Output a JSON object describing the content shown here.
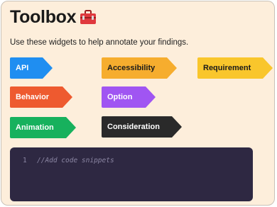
{
  "header": {
    "title": "Toolbox",
    "icon": "toolbox-icon"
  },
  "subtitle": "Use these widgets to help annotate your findings.",
  "tags": [
    {
      "label": "API",
      "color": "#1f8ef1"
    },
    {
      "label": "Accessibility",
      "color": "#f6ad2e"
    },
    {
      "label": "Requirement",
      "color": "#f9c62c"
    },
    {
      "label": "Behavior",
      "color": "#ee5a2f"
    },
    {
      "label": "Option",
      "color": "#a055f2"
    },
    {
      "label": "Animation",
      "color": "#17b15d"
    },
    {
      "label": "Consideration",
      "color": "#2a2a2a"
    }
  ],
  "code_editor": {
    "line_number": "1",
    "placeholder_text": "//Add code snippets",
    "background": "#2e2842"
  },
  "colors": {
    "page_background": "#fdeedb"
  }
}
